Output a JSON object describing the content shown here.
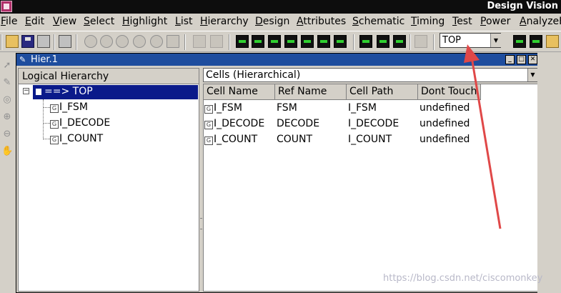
{
  "title_bar": {
    "title": "Design Vision"
  },
  "menu": {
    "items": [
      "File",
      "Edit",
      "View",
      "Select",
      "Highlight",
      "List",
      "Hierarchy",
      "Design",
      "Attributes",
      "Schematic",
      "Timing",
      "Test",
      "Power",
      "AnalyzeF"
    ]
  },
  "toolbar": {
    "design_selector": {
      "value": "TOP"
    }
  },
  "hier_window": {
    "title": "Hier.1",
    "logical_hierarchy_label": "Logical Hierarchy",
    "tree": {
      "root": "==> TOP",
      "children": [
        "I_FSM",
        "I_DECODE",
        "I_COUNT"
      ]
    },
    "cells_selector": {
      "value": "Cells (Hierarchical)"
    },
    "table": {
      "columns": [
        "Cell Name",
        "Ref Name",
        "Cell Path",
        "Dont Touch"
      ],
      "rows": [
        [
          "I_FSM",
          "FSM",
          "I_FSM",
          "undefined"
        ],
        [
          "I_DECODE",
          "DECODE",
          "I_DECODE",
          "undefined"
        ],
        [
          "I_COUNT",
          "COUNT",
          "I_COUNT",
          "undefined"
        ]
      ]
    }
  },
  "watermark": "https://blog.csdn.net/ciscomonkey",
  "colors": {
    "title_blue": "#1e4d9e",
    "selection": "#0a1a8a",
    "annotation_arrow": "#e04848"
  }
}
